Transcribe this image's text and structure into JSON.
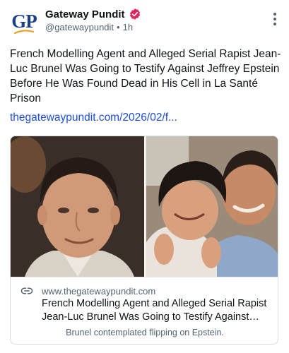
{
  "author": {
    "avatar_text": "GP",
    "display_name": "Gateway Pundit",
    "handle": "@gatewaypundit",
    "separator": "•",
    "time": "1h",
    "verified_badge": "verified-badge-icon"
  },
  "post": {
    "text": "French Modelling Agent and Alleged Serial Rapist Jean-Luc Brunel Was Going to Testify Against Jeffrey Epstein Before He Was Found Dead in His Cell in La Santé Prison",
    "link_text": "thegatewaypundit.com/2026/02/f..."
  },
  "card": {
    "domain": "www.thegatewaypundit.com",
    "title": "French Modelling Agent and Alleged Serial Rapist Jean-Luc Brunel Was Going to Testify Against Jeffrey Epstein",
    "description": "Brunel contemplated flipping on Epstein."
  },
  "colors": {
    "accent_link": "#1d4ed8",
    "badge": "#e0245e",
    "brand_navy": "#1d3f8a",
    "brand_orange": "#f0a020"
  },
  "icons": {
    "more": "more-vertical-icon",
    "link": "link-icon"
  }
}
